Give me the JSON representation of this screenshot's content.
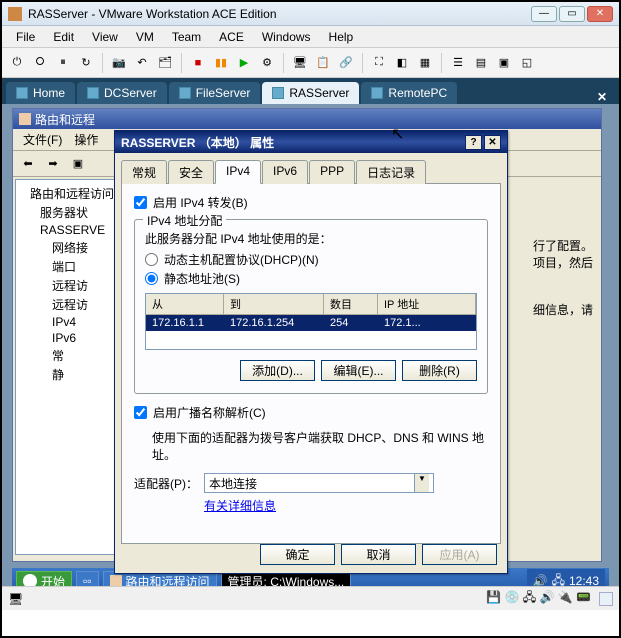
{
  "window": {
    "title": "RASServer - VMware Workstation ACE Edition",
    "menus": [
      "File",
      "Edit",
      "View",
      "VM",
      "Team",
      "ACE",
      "Windows",
      "Help"
    ]
  },
  "tabs": [
    {
      "label": "Home"
    },
    {
      "label": "DCServer"
    },
    {
      "label": "FileServer"
    },
    {
      "label": "RASServer",
      "active": true
    },
    {
      "label": "RemotePC"
    }
  ],
  "inner": {
    "title": "路由和远程",
    "menus": [
      "文件(F)",
      "操作"
    ],
    "tree": [
      "路由和远程访问",
      "服务器状",
      "RASSERVE",
      "网络接",
      "端口",
      "远程访",
      "远程访",
      "IPv4",
      "IPv6",
      "常",
      "静"
    ]
  },
  "dialog": {
    "title": "RASSERVER （本地） 属性",
    "tabs": [
      "常规",
      "安全",
      "IPv4",
      "IPv6",
      "PPP",
      "日志记录"
    ],
    "active_tab": "IPv4",
    "chk_forward": "启用 IPv4 转发(B)",
    "group_label": "IPv4 地址分配",
    "group_text": "此服务器分配 IPv4 地址使用的是：",
    "radio_dhcp": "动态主机配置协议(DHCP)(N)",
    "radio_static": "静态地址池(S)",
    "selected_radio": "static",
    "table": {
      "cols": [
        "从",
        "到",
        "数目",
        "IP 地址"
      ],
      "row": [
        "172.16.1.1",
        "172.16.1.254",
        "254",
        "172.1..."
      ]
    },
    "btn_add": "添加(D)...",
    "btn_edit": "编辑(E)...",
    "btn_del": "删除(R)",
    "chk_broadcast": "启用广播名称解析(C)",
    "adapter_text": "使用下面的适配器为拨号客户端获取 DHCP、DNS 和 WINS 地址。",
    "adapter_label": "适配器(P)：",
    "adapter_value": "本地连接",
    "link_more": "有关详细信息",
    "btn_ok": "确定",
    "btn_cancel": "取消",
    "btn_apply": "应用(A)"
  },
  "side_text": {
    "l1": "行了配置。",
    "l2": "项目，然后",
    "l3": "细信息，请"
  },
  "taskbar": {
    "start": "开始",
    "task1": "路由和远程访问",
    "task2": "管理员: C:\\Windows...",
    "clock": "12:43"
  }
}
